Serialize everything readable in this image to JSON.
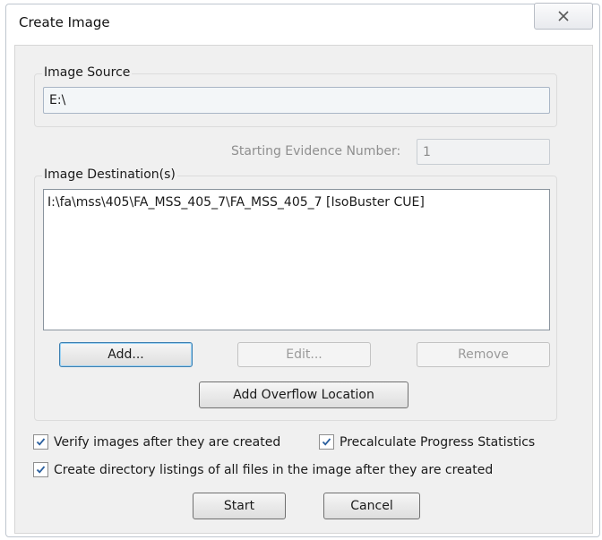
{
  "window": {
    "title": "Create Image",
    "close_icon": "close-icon"
  },
  "image_source": {
    "group_label": "Image Source",
    "value": "E:\\"
  },
  "starting_evidence": {
    "label": "Starting Evidence Number:",
    "value": "1"
  },
  "image_destinations": {
    "group_label": "Image Destination(s)",
    "items": [
      "I:\\fa\\mss\\405\\FA_MSS_405_7\\FA_MSS_405_7 [IsoBuster CUE]"
    ],
    "add_label": "Add...",
    "edit_label": "Edit...",
    "remove_label": "Remove",
    "add_overflow_label": "Add Overflow Location"
  },
  "options": {
    "verify": {
      "label": "Verify images after they are created",
      "checked": true
    },
    "precalculate": {
      "label": "Precalculate Progress Statistics",
      "checked": true
    },
    "directory_listings": {
      "label": "Create directory listings of all files in the image after they are created",
      "checked": true
    },
    "check_icon": "checkmark-icon"
  },
  "footer": {
    "start_label": "Start",
    "cancel_label": "Cancel"
  }
}
